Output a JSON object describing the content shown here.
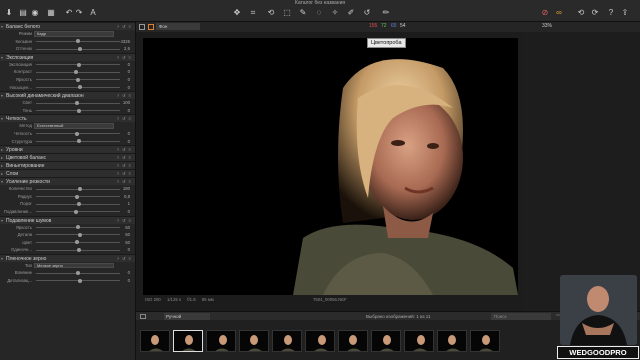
{
  "window": {
    "title": "Каталог без названия"
  },
  "toolbar": {
    "zoom": "33%",
    "hist_values": [
      "155",
      "72",
      "65",
      "54"
    ]
  },
  "viewer": {
    "preset_label": "Фон",
    "tooltip": "Цветопроба",
    "filename": "7504_00056.NEF",
    "meta": [
      "ISO 200",
      "1/125 s",
      "f/1.8",
      "85 мм"
    ]
  },
  "filmstrip": {
    "sort": "Ручной",
    "selection": "Выбрано изображений: 1 из 11",
    "search": "Поиск"
  },
  "badge": "WEDGOODPRO",
  "panel": {
    "sections": [
      {
        "title": "Баланс белого",
        "rows": [
          {
            "label": "Режим",
            "dropdown": "Кадр"
          },
          {
            "label": "Кельвин",
            "value": "4326"
          },
          {
            "label": "Оттенок",
            "value": "2,6"
          }
        ]
      },
      {
        "title": "Экспозиция",
        "rows": [
          {
            "label": "Экспозиция",
            "value": "0"
          },
          {
            "label": "Контраст",
            "value": "0"
          },
          {
            "label": "Яркость",
            "value": "0"
          },
          {
            "label": "Насыщен...",
            "value": "0"
          }
        ]
      },
      {
        "title": "Высокий динамический диапазон",
        "rows": [
          {
            "label": "Свет",
            "value": "100"
          },
          {
            "label": "Тень",
            "value": "0"
          }
        ]
      },
      {
        "title": "Четкость",
        "rows": [
          {
            "label": "Метод",
            "dropdown": "Естественный"
          },
          {
            "label": "Четкость",
            "value": "0"
          },
          {
            "label": "Структура",
            "value": "0"
          }
        ]
      },
      {
        "title": "Уровни",
        "rows": []
      },
      {
        "title": "Цветовой баланс",
        "rows": []
      },
      {
        "title": "Виньетирование",
        "rows": []
      },
      {
        "title": "Слои",
        "rows": []
      },
      {
        "title": "Усиление резкости",
        "rows": [
          {
            "label": "Количество",
            "value": "180"
          },
          {
            "label": "Радиус",
            "value": "0,8"
          },
          {
            "label": "Порог",
            "value": "1"
          },
          {
            "label": "Подавление...",
            "value": "0"
          }
        ]
      },
      {
        "title": "Подавление шумов",
        "rows": [
          {
            "label": "Яркость",
            "value": "50"
          },
          {
            "label": "Детали",
            "value": "50"
          },
          {
            "label": "Цвет",
            "value": "50"
          },
          {
            "label": "Одиночн...",
            "value": "0"
          }
        ]
      },
      {
        "title": "Пленочное зерно",
        "rows": [
          {
            "label": "Тип",
            "dropdown": "Мелкое зерно"
          },
          {
            "label": "Влияние",
            "value": "0"
          },
          {
            "label": "Детализац...",
            "value": "0"
          }
        ]
      }
    ]
  }
}
